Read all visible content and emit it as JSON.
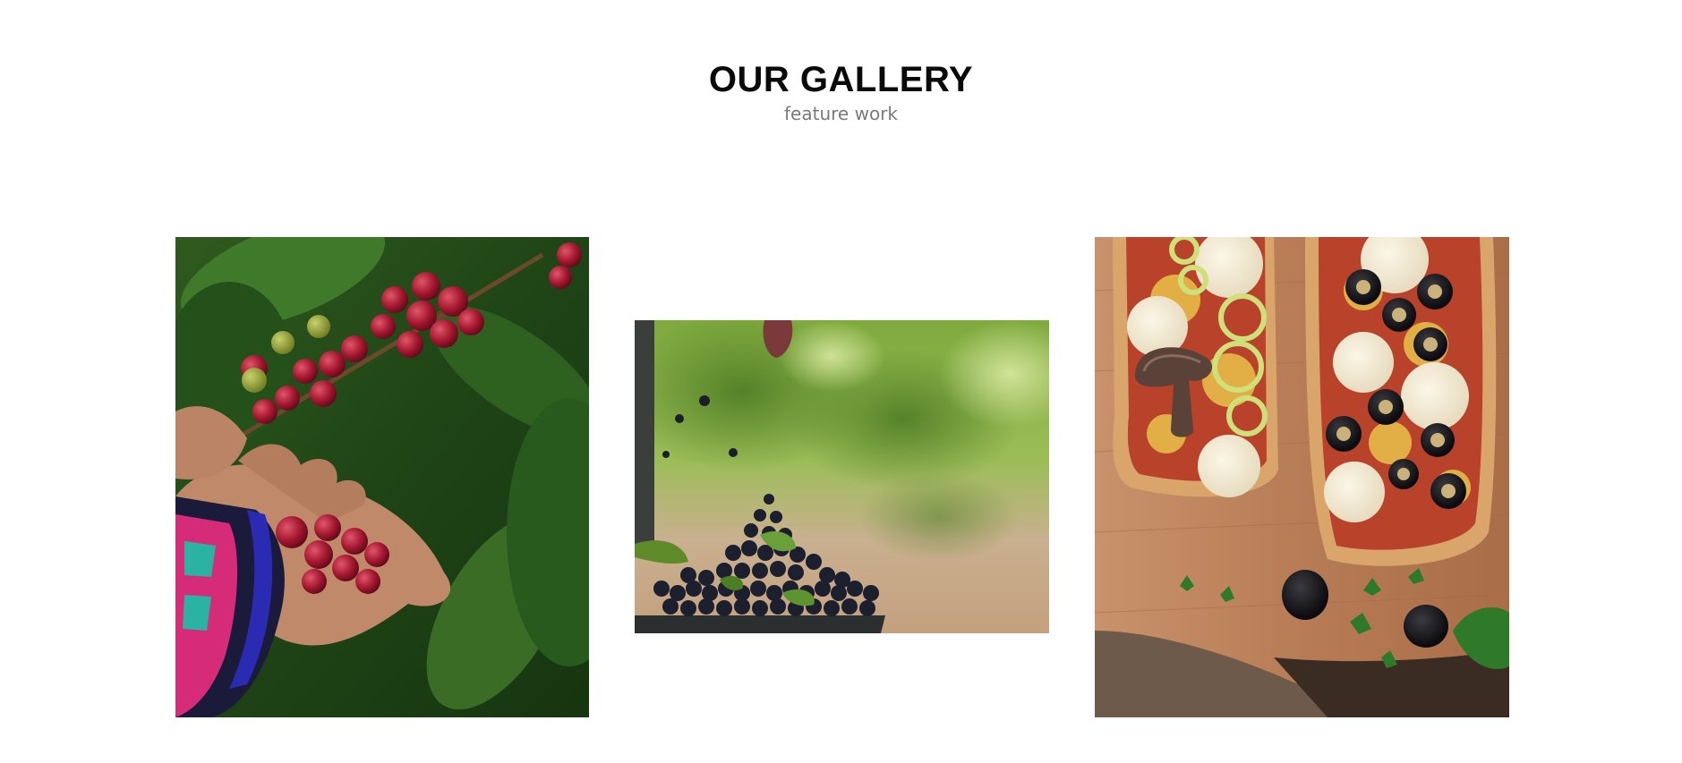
{
  "header": {
    "title": "OUR GALLERY",
    "subtitle": "feature work"
  },
  "gallery": {
    "items": [
      {
        "alt": "Coffee cherries in a hand",
        "icon": "photo-coffee-cherries"
      },
      {
        "alt": "Dark berries falling into a bowl",
        "icon": "photo-berries"
      },
      {
        "alt": "Pizza baguettes with olives and mushrooms",
        "icon": "photo-pizza-baguettes"
      }
    ]
  },
  "colors": {
    "title": "#0a0a0a",
    "subtitle": "#7a7a7a",
    "background": "#ffffff"
  }
}
